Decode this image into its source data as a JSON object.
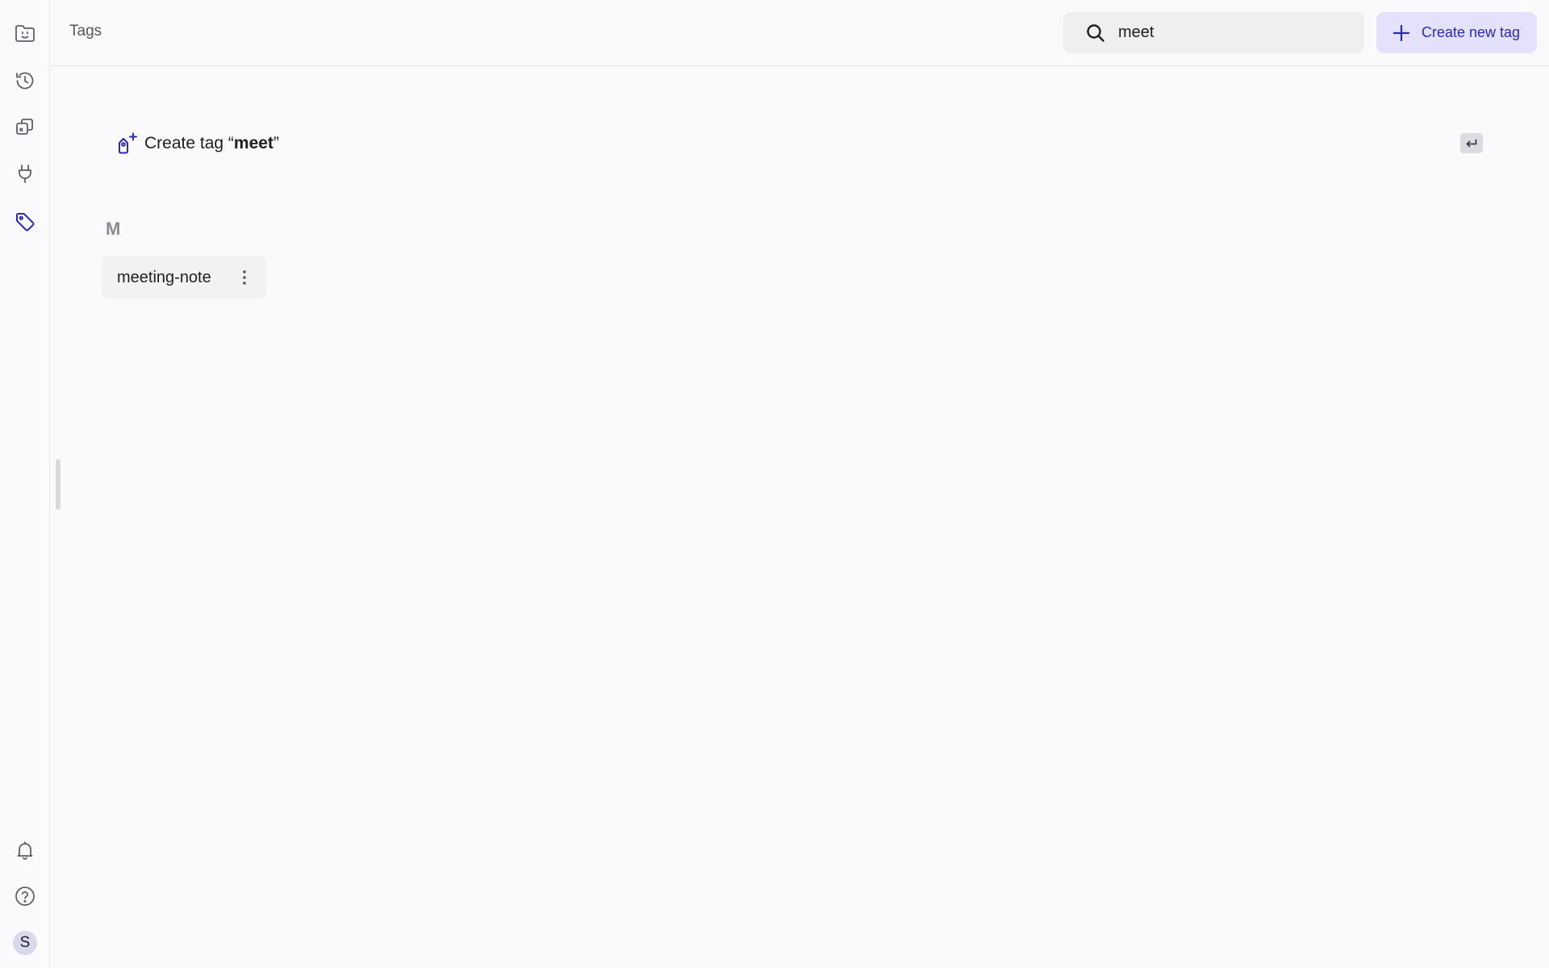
{
  "header": {
    "title": "Tags",
    "search": {
      "value": "meet",
      "placeholder": ""
    },
    "create_button_label": "Create new tag"
  },
  "sidebar": {
    "items": [
      {
        "name": "home",
        "icon": "smiley-folder-icon"
      },
      {
        "name": "history",
        "icon": "history-icon"
      },
      {
        "name": "copies",
        "icon": "copy-icon"
      },
      {
        "name": "integrations",
        "icon": "plug-icon"
      },
      {
        "name": "tags",
        "icon": "tag-icon",
        "active": true
      }
    ],
    "bottom": [
      {
        "name": "notifications",
        "icon": "bell-icon"
      },
      {
        "name": "help",
        "icon": "help-circle-icon"
      }
    ],
    "avatar_initial": "S"
  },
  "main": {
    "create_suggestion": {
      "prefix": "Create tag “",
      "query": "meet",
      "suffix": "”",
      "shortcut_icon": "enter-key-icon"
    },
    "groups": [
      {
        "letter": "M",
        "tags": [
          {
            "label": "meeting-note"
          }
        ]
      }
    ]
  },
  "colors": {
    "accent": "#2b2bb8",
    "accent_bg": "#e3e1fb",
    "background": "#fafafc"
  }
}
